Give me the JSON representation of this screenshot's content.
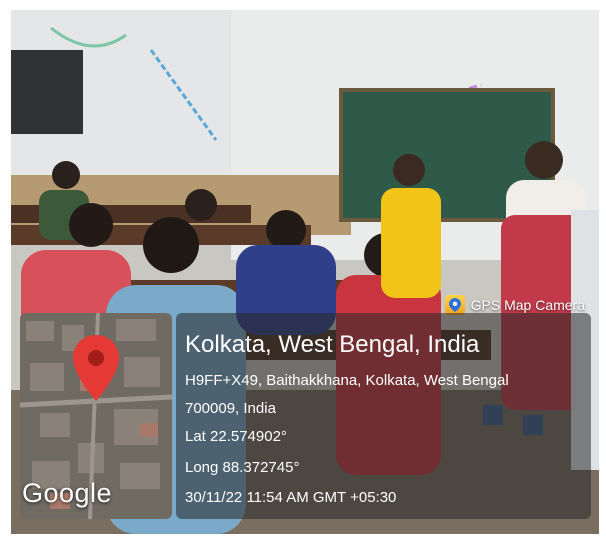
{
  "watermark": {
    "label": "GPS Map Camera",
    "icon": "camera-pin-icon"
  },
  "map": {
    "logo_text": "Google",
    "pin_color": "#e53935"
  },
  "location": {
    "title": "Kolkata, West Bengal, India",
    "address_line1": "H9FF+X49, Baithakkhana, Kolkata, West Bengal",
    "address_line2": "700009, India",
    "lat": "Lat 22.574902°",
    "long": "Long 88.372745°",
    "datetime": "30/11/22 11:54 AM GMT +05:30"
  },
  "colors": {
    "board": "#2f5a49",
    "saree": "#f2c418",
    "overlay": "#2a2a2a"
  }
}
